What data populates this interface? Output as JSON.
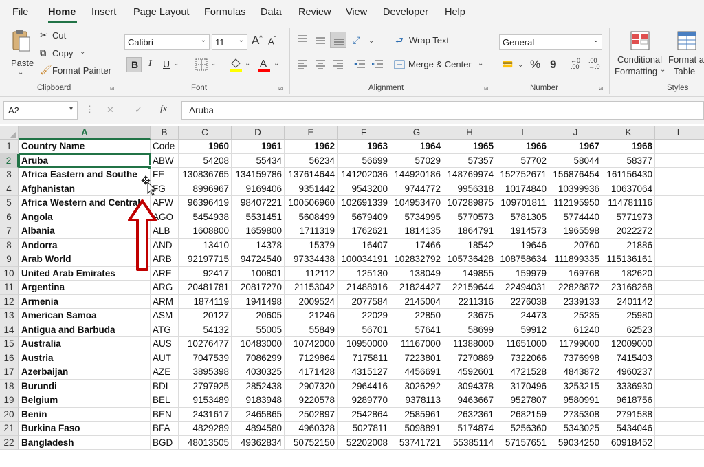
{
  "menu": {
    "tabs": [
      "File",
      "Home",
      "Insert",
      "Page Layout",
      "Formulas",
      "Data",
      "Review",
      "View",
      "Developer",
      "Help"
    ],
    "active": "Home"
  },
  "ribbon": {
    "clipboard": {
      "paste": "Paste",
      "cut": "Cut",
      "copy": "Copy",
      "format_painter": "Format Painter",
      "label": "Clipboard"
    },
    "font": {
      "name": "Calibri",
      "size": "11",
      "grow": "A",
      "shrink": "A",
      "bold": "B",
      "italic": "I",
      "underline": "U",
      "label": "Font",
      "fill_color": "#ffff00",
      "font_color": "#ff0000"
    },
    "alignment": {
      "wrap_text": "Wrap Text",
      "merge_center": "Merge & Center",
      "label": "Alignment"
    },
    "number": {
      "format": "General",
      "percent": "%",
      "comma": "9",
      "label": "Number"
    },
    "styles": {
      "conditional": "Conditional",
      "formatting": "Formatting",
      "format_as": "Format as",
      "table": "Table",
      "label": "Styles"
    }
  },
  "formula_bar": {
    "name_box": "A2",
    "cancel": "✕",
    "enter": "✓",
    "fx": "fx",
    "content": "Aruba"
  },
  "grid": {
    "columns": [
      "A",
      "B",
      "C",
      "D",
      "E",
      "F",
      "G",
      "H",
      "I",
      "J",
      "K",
      "L"
    ],
    "header_row": [
      "Country Name",
      "Code",
      "1960",
      "1961",
      "1962",
      "1963",
      "1964",
      "1965",
      "1966",
      "1967",
      "1968"
    ],
    "rows": [
      [
        "Aruba",
        "ABW",
        "54208",
        "55434",
        "56234",
        "56699",
        "57029",
        "57357",
        "57702",
        "58044",
        "58377"
      ],
      [
        "Africa Eastern and Southe",
        "FE",
        "130836765",
        "134159786",
        "137614644",
        "141202036",
        "144920186",
        "148769974",
        "152752671",
        "156876454",
        "161156430"
      ],
      [
        "Afghanistan",
        "FG",
        "8996967",
        "9169406",
        "9351442",
        "9543200",
        "9744772",
        "9956318",
        "10174840",
        "10399936",
        "10637064"
      ],
      [
        "Africa Western and Central",
        "AFW",
        "96396419",
        "98407221",
        "100506960",
        "102691339",
        "104953470",
        "107289875",
        "109701811",
        "112195950",
        "114781116"
      ],
      [
        "Angola",
        "AGO",
        "5454938",
        "5531451",
        "5608499",
        "5679409",
        "5734995",
        "5770573",
        "5781305",
        "5774440",
        "5771973"
      ],
      [
        "Albania",
        "ALB",
        "1608800",
        "1659800",
        "1711319",
        "1762621",
        "1814135",
        "1864791",
        "1914573",
        "1965598",
        "2022272"
      ],
      [
        "Andorra",
        "AND",
        "13410",
        "14378",
        "15379",
        "16407",
        "17466",
        "18542",
        "19646",
        "20760",
        "21886"
      ],
      [
        "Arab World",
        "ARB",
        "92197715",
        "94724540",
        "97334438",
        "100034191",
        "102832792",
        "105736428",
        "108758634",
        "111899335",
        "115136161"
      ],
      [
        "United Arab Emirates",
        "ARE",
        "92417",
        "100801",
        "112112",
        "125130",
        "138049",
        "149855",
        "159979",
        "169768",
        "182620"
      ],
      [
        "Argentina",
        "ARG",
        "20481781",
        "20817270",
        "21153042",
        "21488916",
        "21824427",
        "22159644",
        "22494031",
        "22828872",
        "23168268"
      ],
      [
        "Armenia",
        "ARM",
        "1874119",
        "1941498",
        "2009524",
        "2077584",
        "2145004",
        "2211316",
        "2276038",
        "2339133",
        "2401142"
      ],
      [
        "American Samoa",
        "ASM",
        "20127",
        "20605",
        "21246",
        "22029",
        "22850",
        "23675",
        "24473",
        "25235",
        "25980"
      ],
      [
        "Antigua and Barbuda",
        "ATG",
        "54132",
        "55005",
        "55849",
        "56701",
        "57641",
        "58699",
        "59912",
        "61240",
        "62523"
      ],
      [
        "Australia",
        "AUS",
        "10276477",
        "10483000",
        "10742000",
        "10950000",
        "11167000",
        "11388000",
        "11651000",
        "11799000",
        "12009000"
      ],
      [
        "Austria",
        "AUT",
        "7047539",
        "7086299",
        "7129864",
        "7175811",
        "7223801",
        "7270889",
        "7322066",
        "7376998",
        "7415403"
      ],
      [
        "Azerbaijan",
        "AZE",
        "3895398",
        "4030325",
        "4171428",
        "4315127",
        "4456691",
        "4592601",
        "4721528",
        "4843872",
        "4960237"
      ],
      [
        "Burundi",
        "BDI",
        "2797925",
        "2852438",
        "2907320",
        "2964416",
        "3026292",
        "3094378",
        "3170496",
        "3253215",
        "3336930"
      ],
      [
        "Belgium",
        "BEL",
        "9153489",
        "9183948",
        "9220578",
        "9289770",
        "9378113",
        "9463667",
        "9527807",
        "9580991",
        "9618756"
      ],
      [
        "Benin",
        "BEN",
        "2431617",
        "2465865",
        "2502897",
        "2542864",
        "2585961",
        "2632361",
        "2682159",
        "2735308",
        "2791588"
      ],
      [
        "Burkina Faso",
        "BFA",
        "4829289",
        "4894580",
        "4960328",
        "5027811",
        "5098891",
        "5174874",
        "5256360",
        "5343025",
        "5434046"
      ],
      [
        "Bangladesh",
        "BGD",
        "48013505",
        "49362834",
        "50752150",
        "52202008",
        "53741721",
        "55385114",
        "57157651",
        "59034250",
        "60918452"
      ]
    ],
    "selected_cell": "A2",
    "accent": "#217346",
    "annotation_arrow_color": "#c00000"
  }
}
